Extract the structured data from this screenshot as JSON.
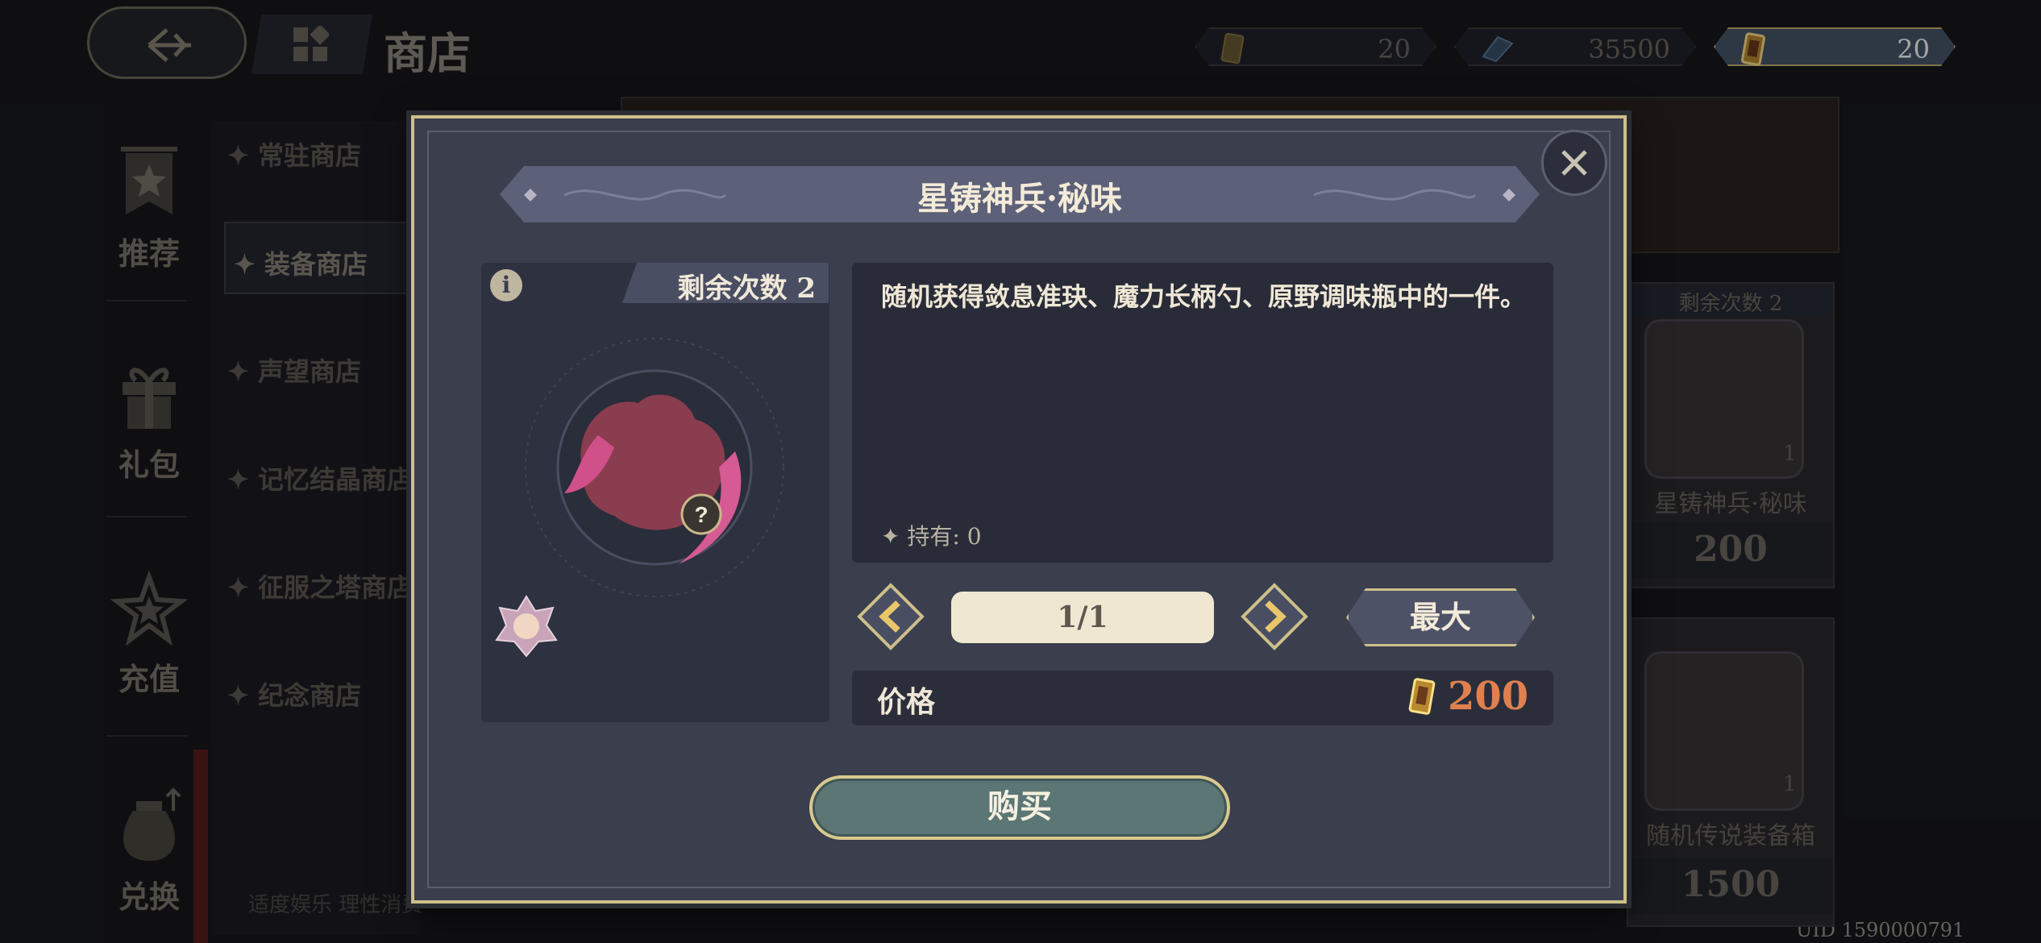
{
  "topbar": {
    "title": "商店",
    "currencies": [
      {
        "icon": "ticket-icon",
        "value": "20"
      },
      {
        "icon": "crystal-icon",
        "value": "35500"
      },
      {
        "icon": "gold-ticket-icon",
        "value": "20"
      }
    ]
  },
  "sidebar": {
    "items": [
      {
        "label": "推荐",
        "icon": "star-banner-icon"
      },
      {
        "label": "礼包",
        "icon": "gift-icon"
      },
      {
        "label": "充值",
        "icon": "star-icon"
      },
      {
        "label": "兑换",
        "icon": "money-bag-icon"
      }
    ]
  },
  "shops": [
    {
      "label": "✦ 常驻商店"
    },
    {
      "label": "✦ 装备商店"
    },
    {
      "label": "✦ 声望商店"
    },
    {
      "label": "✦ 记忆结晶商店"
    },
    {
      "label": "✦ 征服之塔商店"
    },
    {
      "label": "✦ 纪念商店"
    }
  ],
  "footer_note": "适度娱乐 理性消费",
  "uid": "UID 1590000791",
  "bg_cards": [
    {
      "count": "剩余次数  2",
      "name": "星铸神兵·秘味",
      "price": "200",
      "qty": "1"
    },
    {
      "name": "随机传说装备箱",
      "price": "1500",
      "qty": "1"
    }
  ],
  "modal": {
    "title": "星铸神兵·秘味",
    "remaining": "剩余次数  2",
    "description": "随机获得敛息准玦、魔力长柄勺、原野调味瓶中的一件。",
    "owned": "✦ 持有: 0",
    "quantity": "1/1",
    "max_label": "最大",
    "price_label": "价格",
    "price_value": "200",
    "buy_label": "购买",
    "price_color": "#e0804e"
  }
}
